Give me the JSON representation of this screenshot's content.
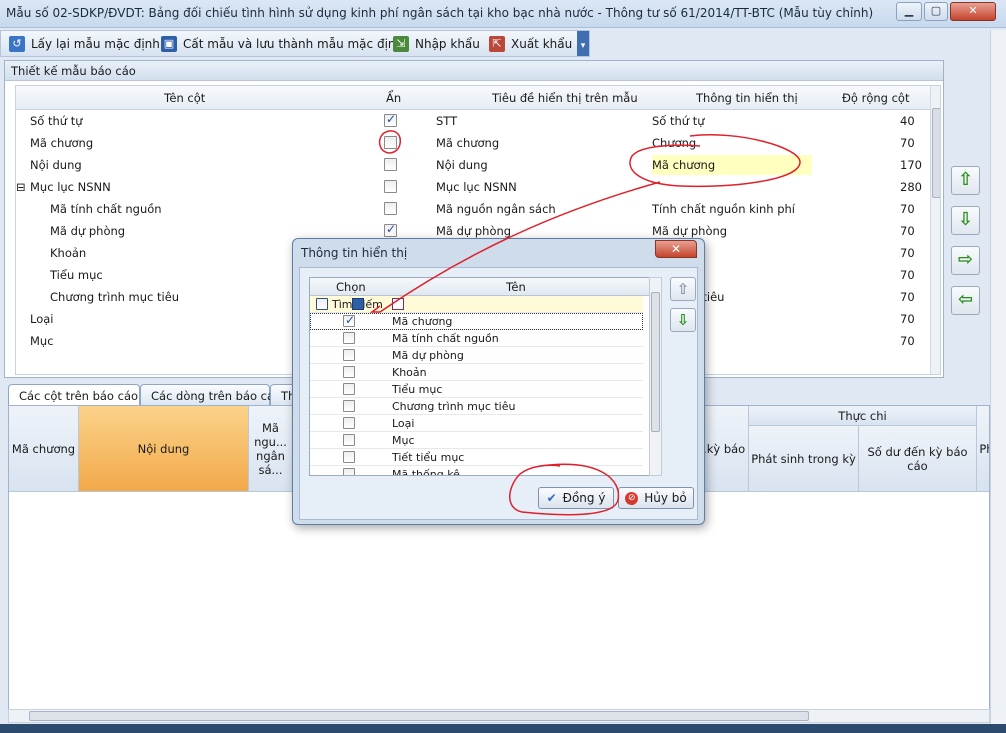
{
  "window": {
    "title": "Mẫu số 02-SDKP/ĐVDT: Bảng đối chiếu tình hình sử dụng kinh phí ngân sách tại kho bạc nhà nước - Thông tư số 61/2014/TT-BTC (Mẫu tùy chỉnh)"
  },
  "toolbar": {
    "reset_label": "Lấy lại mẫu mặc định",
    "save_default_label": "Cất mẫu và lưu thành mẫu mặc định",
    "import_label": "Nhập khẩu",
    "export_label": "Xuất khẩu"
  },
  "design": {
    "panel_title": "Thiết kế mẫu báo cáo",
    "headers": {
      "col_name": "Tên cột",
      "hidden": "Ẩn",
      "caption": "Tiêu đề hiển thị trên mẫu",
      "info": "Thông tin hiển thị",
      "width": "Độ rộng cột"
    },
    "rows": [
      {
        "name": "Số thứ tự",
        "hidden": true,
        "caption": "STT",
        "info": "Số thứ tự",
        "width": "40"
      },
      {
        "name": "Mã chương",
        "hidden": false,
        "caption": "Mã chương",
        "info": "Chương",
        "width": "70"
      },
      {
        "name": "Nội dung",
        "hidden": false,
        "caption": "Nội dung",
        "info": "Mã chương",
        "width": "170"
      },
      {
        "name": "Mục lục NSNN",
        "hidden": false,
        "caption": "Mục lục NSNN",
        "info": "",
        "width": "280"
      },
      {
        "name": "Mã tính chất nguồn",
        "hidden": false,
        "caption": "Mã nguồn ngân sách",
        "info": "Tính chất nguồn kinh phí",
        "width": "70"
      },
      {
        "name": "Mã dự phòng",
        "hidden": true,
        "caption": "Mã dự phòng",
        "info": "Mã dự phòng",
        "width": "70"
      },
      {
        "name": "Khoản",
        "hidden": false,
        "caption": "",
        "info": "...ản",
        "width": "70"
      },
      {
        "name": "Tiểu mục",
        "hidden": false,
        "caption": "",
        "info": "",
        "width": "70"
      },
      {
        "name": "Chương trình mục tiêu",
        "hidden": false,
        "caption": "",
        "info": "...h mục tiêu",
        "width": "70"
      },
      {
        "name": "Loại",
        "hidden": false,
        "caption": "",
        "info": "",
        "width": "70"
      },
      {
        "name": "Mục",
        "hidden": false,
        "caption": "",
        "info": "",
        "width": "70"
      }
    ],
    "collapse_glyph": "⊟"
  },
  "tabs": [
    {
      "label": "Các cột trên báo cáo"
    },
    {
      "label": "Các dòng trên báo cáo"
    },
    {
      "label": "Th"
    }
  ],
  "report": {
    "cols": [
      "Mã chương",
      "Nội dung",
      "Mã ngu... ngân sá...",
      "...kỳ báo",
      "Phát sinh trong kỳ",
      "Số dư đến kỳ báo cáo",
      "Ph"
    ],
    "group_header": "Thực chi"
  },
  "dialog": {
    "title": "Thông tin hiển thị",
    "header_select": "Chọn",
    "header_name": "Tên",
    "search_label": "Tìm kiếm",
    "rows": [
      {
        "name": "Mã chương",
        "checked": true
      },
      {
        "name": "Mã tính chất nguồn",
        "checked": false
      },
      {
        "name": "Mã dự phòng",
        "checked": false
      },
      {
        "name": "Khoản",
        "checked": false
      },
      {
        "name": "Tiểu mục",
        "checked": false
      },
      {
        "name": "Chương trình mục tiêu",
        "checked": false
      },
      {
        "name": "Loại",
        "checked": false
      },
      {
        "name": "Mục",
        "checked": false
      },
      {
        "name": "Tiết tiểu mục",
        "checked": false
      },
      {
        "name": "Mã thống kê",
        "checked": false
      }
    ],
    "ok_label": "Đồng ý",
    "cancel_label": "Hủy bỏ"
  },
  "annotation_color": "#e0202a"
}
